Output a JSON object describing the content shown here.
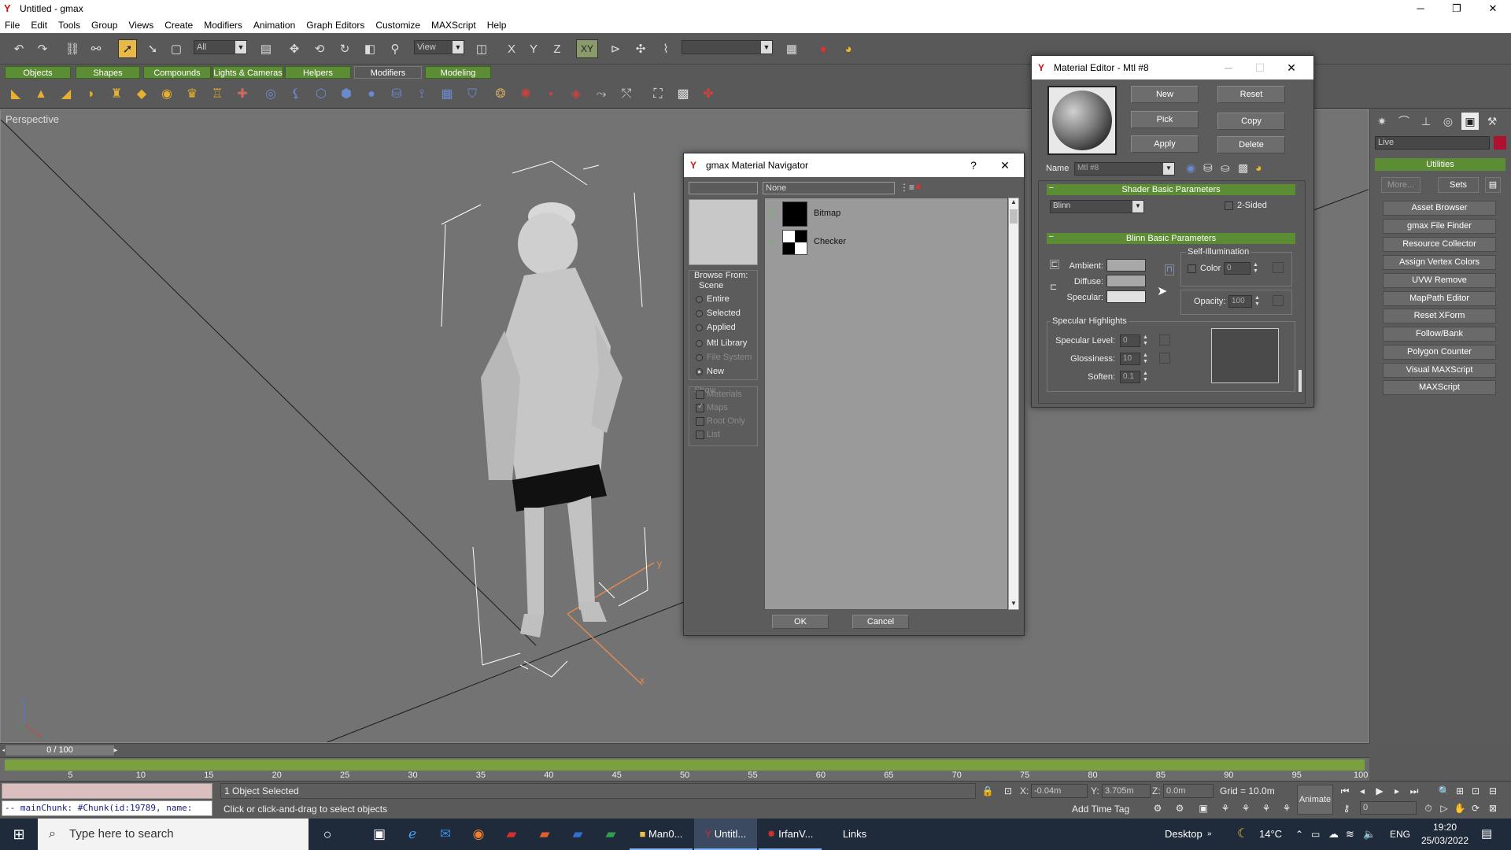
{
  "window": {
    "title": "Untitled - gmax",
    "controls": {
      "minimize": "─",
      "maximize": "❐",
      "close": "✕"
    }
  },
  "menu": [
    "File",
    "Edit",
    "Tools",
    "Group",
    "Views",
    "Create",
    "Modifiers",
    "Animation",
    "Graph Editors",
    "Customize",
    "MAXScript",
    "Help"
  ],
  "toolbar": {
    "selection_filter": "All",
    "reference_coord": "View",
    "axis_label": "XY",
    "named_selection": ""
  },
  "tabs": [
    "Objects",
    "Shapes",
    "Compounds",
    "Lights & Cameras",
    "Helpers",
    "Modifiers",
    "Modeling"
  ],
  "active_tab": "Modifiers",
  "viewport": {
    "label": "Perspective",
    "axis_x": "x",
    "axis_y": "y",
    "axis_z": "z"
  },
  "command_panel": {
    "live_field": "Live",
    "live_color": "#b01030",
    "rollup_title": "Utilities",
    "more_label": "More...",
    "sets_label": "Sets",
    "buttons": [
      "Asset Browser",
      "gmax File Finder",
      "Resource Collector",
      "Assign Vertex Colors",
      "UVW Remove",
      "MapPath Editor",
      "Reset XForm",
      "Follow/Bank",
      "Polygon Counter",
      "Visual MAXScript",
      "MAXScript"
    ]
  },
  "time_slider": {
    "label": "0 / 100",
    "frame_current": 0,
    "frame_total": 100
  },
  "trackbar": {
    "ticks": [
      "5",
      "10",
      "15",
      "20",
      "25",
      "30",
      "35",
      "40",
      "45",
      "50",
      "55",
      "60",
      "65",
      "70",
      "75",
      "80",
      "85",
      "90",
      "95",
      "100"
    ]
  },
  "status": {
    "listener_text": "-- mainChunk: #Chunk(id:19789, name:",
    "selection_text": "1 Object Selected",
    "prompt_text": "Click or click-and-drag to select objects",
    "x_label": "X:",
    "x_value": "-0.04m",
    "y_label": "Y:",
    "y_value": "3.705m",
    "z_label": "Z:",
    "z_value": "0.0m",
    "grid_text": "Grid = 10.0m",
    "add_time_tag": "Add Time Tag",
    "animate_label": "Animate",
    "frame_value": "0"
  },
  "material_editor": {
    "title": "Material Editor - Mtl #8",
    "buttons": {
      "new": "New",
      "reset": "Reset",
      "pick": "Pick",
      "copy": "Copy",
      "apply": "Apply",
      "delete": "Delete"
    },
    "name_label": "Name",
    "name_value": "Mtl #8",
    "shader_rollup": "Shader Basic Parameters",
    "shader_type": "Blinn",
    "two_sided": "2-Sided",
    "blinn_rollup": "Blinn Basic Parameters",
    "ambient": "Ambient:",
    "diffuse": "Diffuse:",
    "specular": "Specular:",
    "self_illum_title": "Self-Illumination",
    "color_label": "Color",
    "color_value": "0",
    "opacity_label": "Opacity:",
    "opacity_value": "100",
    "spec_highlights": "Specular Highlights",
    "spec_level_label": "Specular Level:",
    "spec_level_value": "0",
    "glossiness_label": "Glossiness:",
    "glossiness_value": "10",
    "soften_label": "Soften:",
    "soften_value": "0.1"
  },
  "navigator": {
    "title": "gmax Material Navigator",
    "help": "?",
    "close": "✕",
    "search_value": "None",
    "browse_from": "Browse From:",
    "scene_label": "Scene",
    "radios": [
      {
        "label": "Entire",
        "on": false,
        "dim": false
      },
      {
        "label": "Selected",
        "on": false,
        "dim": false
      },
      {
        "label": "Applied",
        "on": false,
        "dim": false
      },
      {
        "label": "Mtl Library",
        "on": false,
        "dim": false
      },
      {
        "label": "File System",
        "on": false,
        "dim": true
      },
      {
        "label": "New",
        "on": true,
        "dim": false
      }
    ],
    "show_label": "Show",
    "checks": [
      {
        "label": "Materials",
        "on": false
      },
      {
        "label": "Maps",
        "on": true
      },
      {
        "label": "Root Only",
        "on": false
      },
      {
        "label": "List",
        "on": false
      }
    ],
    "items": [
      "Bitmap",
      "Checker"
    ],
    "ok": "OK",
    "cancel": "Cancel"
  },
  "taskbar": {
    "search_placeholder": "Type here to search",
    "apps": [
      "Man0...",
      "Untitl...",
      "IrfanV..."
    ],
    "links": "Links",
    "desktop": "Desktop",
    "temperature": "14°C",
    "language": "ENG",
    "time": "19:20",
    "date": "25/03/2022"
  }
}
